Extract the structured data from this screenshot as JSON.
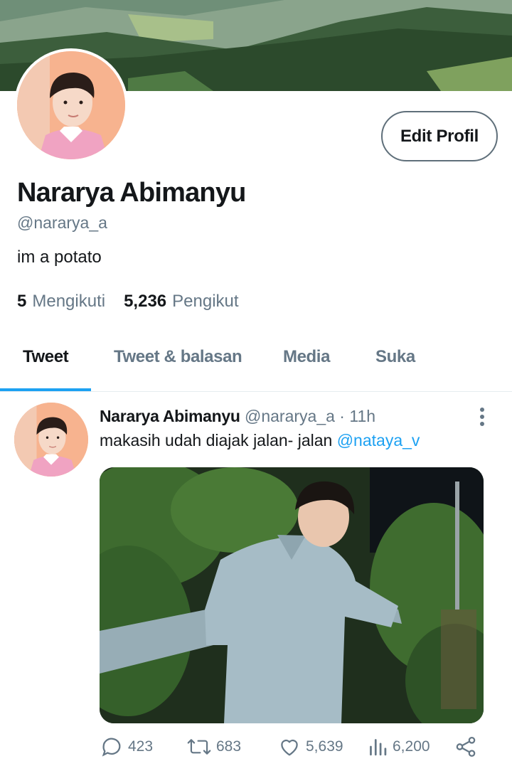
{
  "profile": {
    "display_name": "Nararya Abimanyu",
    "handle": "@nararya_a",
    "bio": "im a potato",
    "edit_button_label": "Edit Profil",
    "following_count": "5",
    "following_label": "Mengikuti",
    "followers_count": "5,236",
    "followers_label": "Pengikut"
  },
  "tabs": [
    {
      "label": "Tweet",
      "active": true
    },
    {
      "label": "Tweet & balasan",
      "active": false
    },
    {
      "label": "Media",
      "active": false
    },
    {
      "label": "Suka",
      "active": false
    }
  ],
  "tweet": {
    "author_name": "Nararya Abimanyu",
    "meta": "@nararya_a · 11h",
    "text": "makasih udah diajak jalan- jalan ",
    "mention": "@nataya_v",
    "replies": "423",
    "retweets": "683",
    "likes": "5,639",
    "views": "6,200"
  },
  "icons": {
    "reply": "reply-icon",
    "retweet": "retweet-icon",
    "like": "heart-icon",
    "views": "views-icon",
    "share": "share-icon",
    "more": "more-vertical-icon"
  },
  "colors": {
    "accent": "#1da1f2",
    "secondary_text": "#657786",
    "primary_text": "#14171a"
  }
}
